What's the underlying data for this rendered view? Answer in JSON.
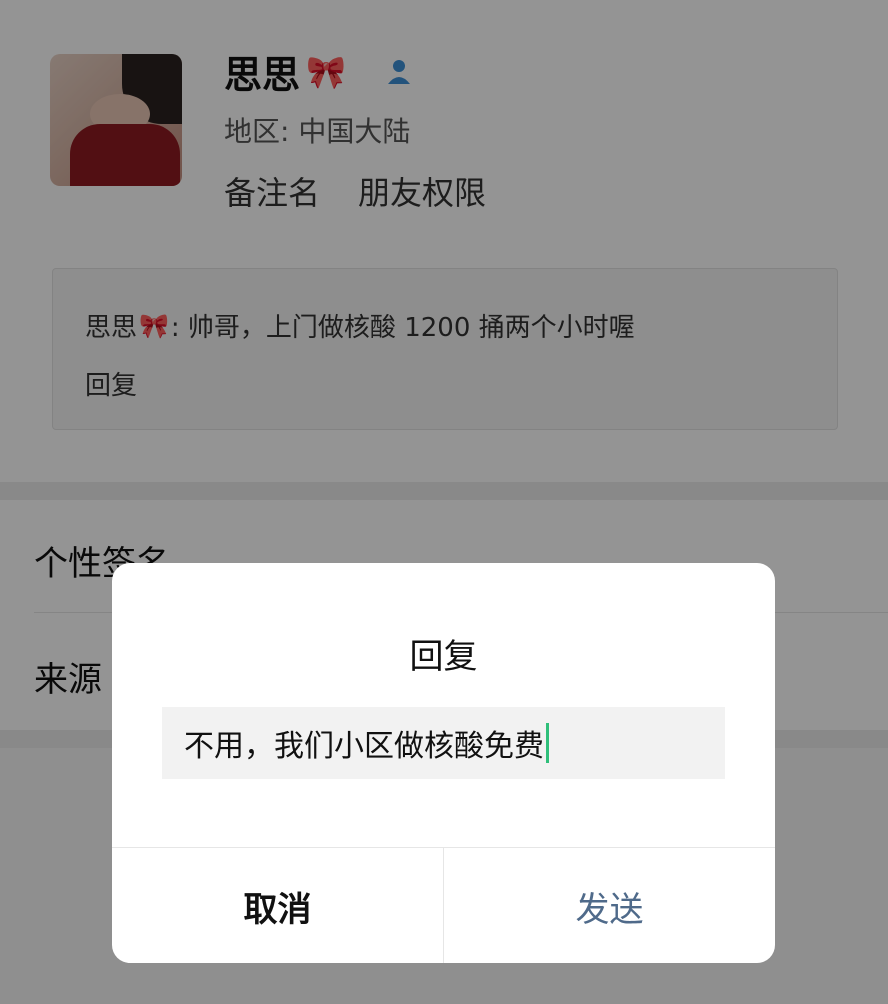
{
  "profile": {
    "name": "思思",
    "name_emoji": "🎀",
    "region": "地区: 中国大陆",
    "remark_label": "备注名",
    "permission_label": "朋友权限"
  },
  "moment": {
    "author": "思思",
    "author_emoji": "🎀",
    "message": ": 帅哥，上门做核酸 1200 捅两个小时喔",
    "reply_label": "回复"
  },
  "rows": {
    "signature_label": "个性签名",
    "source_label": "来源"
  },
  "dialog": {
    "title": "回复",
    "input_value": "不用，我们小区做核酸免费",
    "cancel_label": "取消",
    "send_label": "发送"
  },
  "colors": {
    "caret": "#2fbf7a",
    "send_text": "#4f6a8a",
    "overlay": "rgba(0,0,0,0.42)"
  }
}
